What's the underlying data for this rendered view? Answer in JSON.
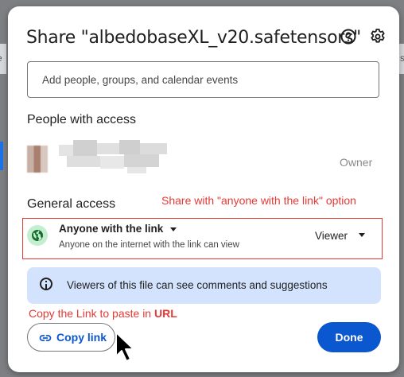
{
  "background": {
    "left_text": "afe",
    "right_text": "saf"
  },
  "dialog": {
    "title": "Share \"albedobaseXL_v20.safetensors\"",
    "help_icon": "help-icon",
    "settings_icon": "settings-gear-icon"
  },
  "add_people": {
    "placeholder": "Add people, groups, and calendar events"
  },
  "people_with_access": {
    "heading": "People with access",
    "entries": [
      {
        "name": "",
        "role": "Owner"
      }
    ]
  },
  "general_access": {
    "heading": "General access",
    "option_label": "Anyone with the link",
    "option_description": "Anyone on the internet with the link can view",
    "role": "Viewer",
    "icon": "globe-icon"
  },
  "annotations": {
    "share_option_note": "Share with \"anyone with the link\" option",
    "copy_note_prefix": "Copy the Link to paste in ",
    "copy_note_emphasis": "URL"
  },
  "info_banner": {
    "text": "Viewers of this file can see comments and suggestions"
  },
  "footer": {
    "copy_link_label": "Copy link",
    "done_label": "Done"
  },
  "colors": {
    "primary": "#0b57d0",
    "annotation_red": "#e53935",
    "banner_bg": "#d3e3fd",
    "globe_bg": "#c4eed0"
  }
}
